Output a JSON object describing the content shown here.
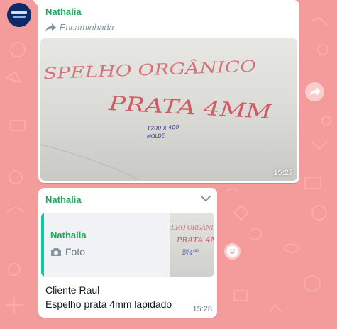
{
  "colors": {
    "background": "#f49b9b",
    "sender": "#1fa855",
    "quote_stripe": "#06cf9c"
  },
  "message1": {
    "sender": "Nathalia",
    "forwarded_label": "Encaminhada",
    "photo_time": "15:27",
    "photo_text": {
      "line1": "SPELHO ORGÂNICO",
      "line2": "PRATA 4MM",
      "line3": "1200 x 400",
      "line4": "MOLDE"
    }
  },
  "message2": {
    "sender": "Nathalia",
    "quote": {
      "sender": "Nathalia",
      "type_label": "Foto"
    },
    "text_line1": "Cliente Raul",
    "text_line2": "Espelho prata 4mm lapidado",
    "time": "15:28"
  },
  "icons": {
    "forward": "forward-arrow-icon",
    "share": "share-forward-icon",
    "chevron": "chevron-down-icon",
    "camera": "camera-icon",
    "emoji": "emoji-smile-icon"
  }
}
